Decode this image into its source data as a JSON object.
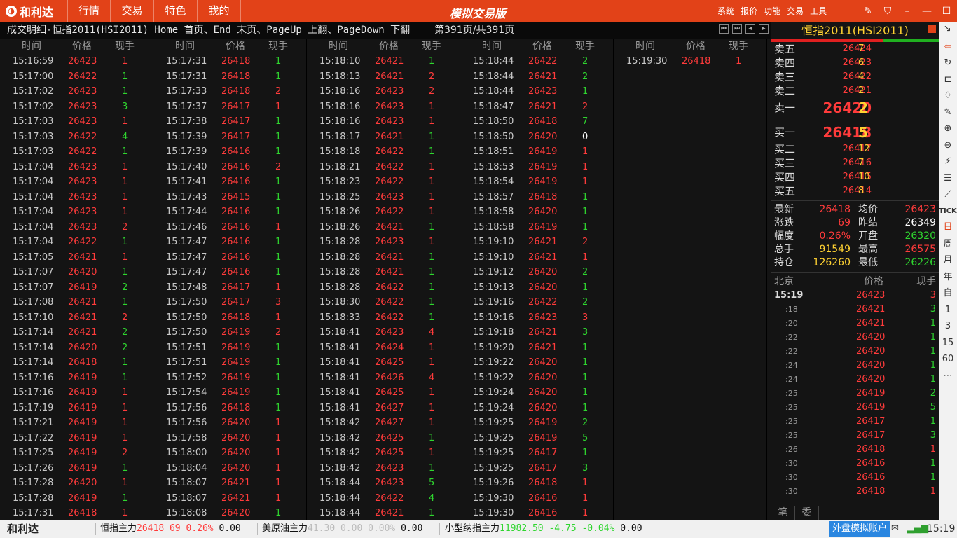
{
  "titlebar": {
    "logo": "和利达",
    "menu": [
      "行情",
      "交易",
      "特色",
      "我的"
    ],
    "app_title": "模拟交易版",
    "links": [
      "系统",
      "报价",
      "功能",
      "交易",
      "工具"
    ]
  },
  "infobar": {
    "title": "成交明细-恒指2011(HSI2011)  Home 首页、End 末页、PageUp 上翻、PageDown 下翻",
    "page": "第391页/共391页"
  },
  "ticks": {
    "headers": {
      "time": "时间",
      "price": "价格",
      "vol": "现手"
    },
    "columns": [
      [
        [
          "15:16:59",
          "26423",
          "1"
        ],
        [
          "15:17:00",
          "26422",
          "1"
        ],
        [
          "15:17:02",
          "26423",
          "1"
        ],
        [
          "15:17:02",
          "26423",
          "3"
        ],
        [
          "15:17:03",
          "26423",
          "1"
        ],
        [
          "15:17:03",
          "26422",
          "4"
        ],
        [
          "15:17:03",
          "26422",
          "1"
        ],
        [
          "15:17:04",
          "26423",
          "1"
        ],
        [
          "15:17:04",
          "26423",
          "1"
        ],
        [
          "15:17:04",
          "26423",
          "1"
        ],
        [
          "15:17:04",
          "26423",
          "1"
        ],
        [
          "15:17:04",
          "26423",
          "2"
        ],
        [
          "15:17:04",
          "26422",
          "1"
        ],
        [
          "15:17:05",
          "26421",
          "1"
        ],
        [
          "15:17:07",
          "26420",
          "1"
        ],
        [
          "15:17:07",
          "26419",
          "2"
        ],
        [
          "15:17:08",
          "26421",
          "1"
        ],
        [
          "15:17:10",
          "26421",
          "2"
        ],
        [
          "15:17:14",
          "26421",
          "2"
        ],
        [
          "15:17:14",
          "26420",
          "2"
        ],
        [
          "15:17:14",
          "26418",
          "1"
        ],
        [
          "15:17:16",
          "26419",
          "1"
        ],
        [
          "15:17:16",
          "26419",
          "1"
        ],
        [
          "15:17:19",
          "26419",
          "1"
        ],
        [
          "15:17:21",
          "26419",
          "1"
        ],
        [
          "15:17:22",
          "26419",
          "1"
        ],
        [
          "15:17:25",
          "26419",
          "2"
        ],
        [
          "15:17:26",
          "26419",
          "1"
        ],
        [
          "15:17:28",
          "26420",
          "1"
        ],
        [
          "15:17:28",
          "26419",
          "1"
        ],
        [
          "15:17:31",
          "26418",
          "1"
        ]
      ],
      [
        [
          "15:17:31",
          "26418",
          "1"
        ],
        [
          "15:17:31",
          "26418",
          "1"
        ],
        [
          "15:17:33",
          "26418",
          "2"
        ],
        [
          "15:17:37",
          "26417",
          "1"
        ],
        [
          "15:17:38",
          "26417",
          "1"
        ],
        [
          "15:17:39",
          "26417",
          "1"
        ],
        [
          "15:17:39",
          "26416",
          "1"
        ],
        [
          "15:17:40",
          "26416",
          "2"
        ],
        [
          "15:17:41",
          "26416",
          "1"
        ],
        [
          "15:17:43",
          "26415",
          "1"
        ],
        [
          "15:17:44",
          "26416",
          "1"
        ],
        [
          "15:17:46",
          "26416",
          "1"
        ],
        [
          "15:17:47",
          "26416",
          "1"
        ],
        [
          "15:17:47",
          "26416",
          "1"
        ],
        [
          "15:17:47",
          "26416",
          "1"
        ],
        [
          "15:17:48",
          "26417",
          "1"
        ],
        [
          "15:17:50",
          "26417",
          "3"
        ],
        [
          "15:17:50",
          "26418",
          "1"
        ],
        [
          "15:17:50",
          "26419",
          "2"
        ],
        [
          "15:17:51",
          "26419",
          "1"
        ],
        [
          "15:17:51",
          "26419",
          "1"
        ],
        [
          "15:17:52",
          "26419",
          "1"
        ],
        [
          "15:17:54",
          "26419",
          "1"
        ],
        [
          "15:17:56",
          "26418",
          "1"
        ],
        [
          "15:17:56",
          "26420",
          "1"
        ],
        [
          "15:17:58",
          "26420",
          "1"
        ],
        [
          "15:18:00",
          "26420",
          "1"
        ],
        [
          "15:18:04",
          "26420",
          "1"
        ],
        [
          "15:18:07",
          "26421",
          "1"
        ],
        [
          "15:18:07",
          "26421",
          "1"
        ],
        [
          "15:18:08",
          "26420",
          "1"
        ]
      ],
      [
        [
          "15:18:10",
          "26421",
          "1"
        ],
        [
          "15:18:13",
          "26421",
          "2"
        ],
        [
          "15:18:16",
          "26423",
          "2"
        ],
        [
          "15:18:16",
          "26423",
          "1"
        ],
        [
          "15:18:16",
          "26423",
          "1"
        ],
        [
          "15:18:17",
          "26421",
          "1"
        ],
        [
          "15:18:18",
          "26422",
          "1"
        ],
        [
          "15:18:21",
          "26422",
          "1"
        ],
        [
          "15:18:23",
          "26422",
          "1"
        ],
        [
          "15:18:25",
          "26423",
          "1"
        ],
        [
          "15:18:26",
          "26422",
          "1"
        ],
        [
          "15:18:26",
          "26421",
          "1"
        ],
        [
          "15:18:28",
          "26423",
          "1"
        ],
        [
          "15:18:28",
          "26421",
          "1"
        ],
        [
          "15:18:28",
          "26421",
          "1"
        ],
        [
          "15:18:28",
          "26422",
          "1"
        ],
        [
          "15:18:30",
          "26422",
          "1"
        ],
        [
          "15:18:33",
          "26422",
          "1"
        ],
        [
          "15:18:41",
          "26423",
          "4"
        ],
        [
          "15:18:41",
          "26424",
          "1"
        ],
        [
          "15:18:41",
          "26425",
          "1"
        ],
        [
          "15:18:41",
          "26426",
          "4"
        ],
        [
          "15:18:41",
          "26425",
          "1"
        ],
        [
          "15:18:41",
          "26427",
          "1"
        ],
        [
          "15:18:42",
          "26427",
          "1"
        ],
        [
          "15:18:42",
          "26425",
          "1"
        ],
        [
          "15:18:42",
          "26425",
          "1"
        ],
        [
          "15:18:42",
          "26423",
          "1"
        ],
        [
          "15:18:44",
          "26423",
          "5"
        ],
        [
          "15:18:44",
          "26422",
          "4"
        ],
        [
          "15:18:44",
          "26421",
          "1"
        ]
      ],
      [
        [
          "15:18:44",
          "26422",
          "2"
        ],
        [
          "15:18:44",
          "26421",
          "2"
        ],
        [
          "15:18:44",
          "26423",
          "1"
        ],
        [
          "15:18:47",
          "26421",
          "2"
        ],
        [
          "15:18:50",
          "26418",
          "7"
        ],
        [
          "15:18:50",
          "26420",
          "0"
        ],
        [
          "15:18:51",
          "26419",
          "1"
        ],
        [
          "15:18:53",
          "26419",
          "1"
        ],
        [
          "15:18:54",
          "26419",
          "1"
        ],
        [
          "15:18:57",
          "26418",
          "1"
        ],
        [
          "15:18:58",
          "26420",
          "1"
        ],
        [
          "15:18:58",
          "26419",
          "1"
        ],
        [
          "15:19:10",
          "26421",
          "2"
        ],
        [
          "15:19:10",
          "26421",
          "1"
        ],
        [
          "15:19:12",
          "26420",
          "2"
        ],
        [
          "15:19:13",
          "26420",
          "1"
        ],
        [
          "15:19:16",
          "26422",
          "2"
        ],
        [
          "15:19:16",
          "26423",
          "3"
        ],
        [
          "15:19:18",
          "26421",
          "3"
        ],
        [
          "15:19:20",
          "26421",
          "1"
        ],
        [
          "15:19:22",
          "26420",
          "1"
        ],
        [
          "15:19:22",
          "26420",
          "1"
        ],
        [
          "15:19:24",
          "26420",
          "1"
        ],
        [
          "15:19:24",
          "26420",
          "1"
        ],
        [
          "15:19:25",
          "26419",
          "2"
        ],
        [
          "15:19:25",
          "26419",
          "5"
        ],
        [
          "15:19:25",
          "26417",
          "1"
        ],
        [
          "15:19:25",
          "26417",
          "3"
        ],
        [
          "15:19:26",
          "26418",
          "1"
        ],
        [
          "15:19:30",
          "26416",
          "1"
        ],
        [
          "15:19:30",
          "26416",
          "1"
        ]
      ],
      [
        [
          "15:19:30",
          "26418",
          "1"
        ]
      ]
    ],
    "vol_colors": [
      [
        "up",
        "dn",
        "dn",
        "dn",
        "up",
        "dn",
        "dn",
        "up",
        "up",
        "up",
        "up",
        "up",
        "dn",
        "up",
        "dn",
        "dn",
        "dn",
        "up",
        "dn",
        "dn",
        "dn",
        "dn",
        "up",
        "up",
        "up",
        "up",
        "up",
        "dn",
        "up",
        "dn",
        "up"
      ],
      [
        "dn",
        "dn",
        "up",
        "up",
        "dn",
        "dn",
        "dn",
        "up",
        "dn",
        "dn",
        "dn",
        "up",
        "dn",
        "dn",
        "dn",
        "up",
        "up",
        "up",
        "up",
        "dn",
        "dn",
        "dn",
        "dn",
        "dn",
        "up",
        "up",
        "up",
        "up",
        "up",
        "up",
        "dn"
      ],
      [
        "dn",
        "up",
        "up",
        "up",
        "up",
        "dn",
        "dn",
        "up",
        "up",
        "up",
        "up",
        "dn",
        "up",
        "dn",
        "dn",
        "dn",
        "dn",
        "dn",
        "up",
        "up",
        "up",
        "up",
        "up",
        "up",
        "up",
        "dn",
        "up",
        "dn",
        "dn",
        "dn",
        "dn"
      ],
      [
        "dn",
        "dn",
        "dn",
        "up",
        "dn",
        "eq",
        "up",
        "up",
        "up",
        "dn",
        "dn",
        "dn",
        "up",
        "up",
        "dn",
        "dn",
        "dn",
        "up",
        "dn",
        "dn",
        "dn",
        "dn",
        "dn",
        "dn",
        "dn",
        "dn",
        "dn",
        "dn",
        "up",
        "up",
        "up"
      ],
      [
        "up"
      ]
    ]
  },
  "rightpanel": {
    "title": "恒指2011(HSI2011)",
    "asks": [
      [
        "卖五",
        "26424",
        "7"
      ],
      [
        "卖四",
        "26423",
        "6"
      ],
      [
        "卖三",
        "26422",
        "4"
      ],
      [
        "卖二",
        "26421",
        "2"
      ],
      [
        "卖一",
        "26420",
        "2"
      ]
    ],
    "bids": [
      [
        "买一",
        "26418",
        "5"
      ],
      [
        "买二",
        "26417",
        "12"
      ],
      [
        "买三",
        "26416",
        "7"
      ],
      [
        "买四",
        "26415",
        "10"
      ],
      [
        "买五",
        "26414",
        "8"
      ]
    ],
    "stats": [
      [
        "最新",
        "26418",
        "rd",
        "均价",
        "26423",
        "rd"
      ],
      [
        "涨跌",
        "69",
        "rd",
        "昨结",
        "26349",
        "wh"
      ],
      [
        "幅度",
        "0.26%",
        "rd",
        "开盘",
        "26320",
        "gn"
      ],
      [
        "总手",
        "91549",
        "yl",
        "最高",
        "26575",
        "rd"
      ],
      [
        "持仓",
        "126260",
        "yl",
        "最低",
        "26226",
        "gn"
      ]
    ],
    "minute_header": {
      "time": "北京",
      "price": "价格",
      "vol": "现手"
    },
    "minute": [
      [
        "15:19",
        "26423",
        "3",
        "rd"
      ],
      [
        ":18",
        "26421",
        "3",
        "gn"
      ],
      [
        ":20",
        "26421",
        "1",
        "gn"
      ],
      [
        ":22",
        "26420",
        "1",
        "gn"
      ],
      [
        ":22",
        "26420",
        "1",
        "gn"
      ],
      [
        ":24",
        "26420",
        "1",
        "gn"
      ],
      [
        ":24",
        "26420",
        "1",
        "gn"
      ],
      [
        ":25",
        "26419",
        "2",
        "gn"
      ],
      [
        ":25",
        "26419",
        "5",
        "gn"
      ],
      [
        ":25",
        "26417",
        "1",
        "gn"
      ],
      [
        ":25",
        "26417",
        "3",
        "gn"
      ],
      [
        ":26",
        "26418",
        "1",
        "rd"
      ],
      [
        ":30",
        "26416",
        "1",
        "gn"
      ],
      [
        ":30",
        "26416",
        "1",
        "gn"
      ],
      [
        ":30",
        "26418",
        "1",
        "rd"
      ]
    ],
    "tabs": [
      "笔",
      "委"
    ]
  },
  "toolbar": [
    "⇲",
    "⇦",
    "↻",
    "⊏",
    "♢",
    "✎",
    "⊕",
    "⊖",
    "⚡",
    "☰",
    "⟋",
    "TICK",
    "日",
    "周",
    "月",
    "年",
    "自",
    "1",
    "3",
    "15",
    "60",
    "⋯"
  ],
  "statusbar": {
    "logo": "和利达",
    "q1": {
      "name": "恒指主力",
      "price": "26418",
      "chg": "69",
      "pct": "0.26%",
      "v": "0.00"
    },
    "q2": {
      "name": "美原油主力",
      "price": "41.30",
      "chg": "0.00",
      "pct": "0.00%",
      "v": "0.00"
    },
    "q3": {
      "name": "小型纳指主力",
      "price": "11982.50",
      "chg": "-4.75",
      "pct": "-0.04%",
      "v": "0.00"
    },
    "account": "外盘模拟账户",
    "time": "15:19"
  }
}
